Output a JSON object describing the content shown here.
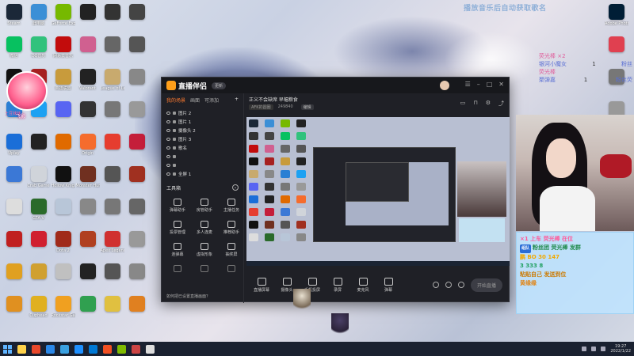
{
  "overlay": {
    "music_hint": "播放音乐后自动获取歌名"
  },
  "desktop_icons": [
    {
      "label": "Steam",
      "color": "#1b2838"
    },
    {
      "label": "此电脑",
      "color": "#3b8fd6"
    },
    {
      "label": "GeForce Experience",
      "color": "#76b900"
    },
    {
      "label": "",
      "color": "#222"
    },
    {
      "label": "",
      "color": "#333"
    },
    {
      "label": "",
      "color": "#444"
    },
    {
      "label": "微信",
      "color": "#07c160"
    },
    {
      "label": "QQ音乐",
      "color": "#31c27c"
    },
    {
      "label": "网易云音乐",
      "color": "#c20c0c"
    },
    {
      "label": "",
      "color": "#d06090"
    },
    {
      "label": "",
      "color": "#666"
    },
    {
      "label": "",
      "color": "#555"
    },
    {
      "label": "",
      "color": "#111"
    },
    {
      "label": "",
      "color": "#a62020"
    },
    {
      "label": "英雄联盟",
      "color": "#c89b3c"
    },
    {
      "label": "Valorant",
      "color": "#222"
    },
    {
      "label": "League of Legends",
      "color": "#c8aa6e"
    },
    {
      "label": "",
      "color": "#888"
    },
    {
      "label": "",
      "color": "#2a7fd4"
    },
    {
      "label": "",
      "color": "#1da1f2"
    },
    {
      "label": "",
      "color": "#5865f2"
    },
    {
      "label": "",
      "color": "#333"
    },
    {
      "label": "",
      "color": "#777"
    },
    {
      "label": "",
      "color": "#999"
    },
    {
      "label": "Uplay",
      "color": "#1a6ed8"
    },
    {
      "label": "",
      "color": "#222"
    },
    {
      "label": "",
      "color": "#e06a00"
    },
    {
      "label": "Origin",
      "color": "#f56c2d"
    },
    {
      "label": "",
      "color": "#e63d2f"
    },
    {
      "label": "",
      "color": "#c41e3a"
    },
    {
      "label": "",
      "color": "#3b78d6"
    },
    {
      "label": "Crab Game",
      "color": "#d0d4da"
    },
    {
      "label": "Hollow Knight",
      "color": "#111"
    },
    {
      "label": "Monster Hunter",
      "color": "#703020"
    },
    {
      "label": "",
      "color": "#555"
    },
    {
      "label": "",
      "color": "#a03020"
    },
    {
      "label": "",
      "color": "#ddd"
    },
    {
      "label": "GTA V",
      "color": "#2a6a2a"
    },
    {
      "label": "",
      "color": "#b8c6d8"
    },
    {
      "label": "",
      "color": "#888"
    },
    {
      "label": "",
      "color": "#777"
    },
    {
      "label": "",
      "color": "#666"
    },
    {
      "label": "",
      "color": "#c02020"
    },
    {
      "label": "",
      "color": "#d02030"
    },
    {
      "label": "Dota 2",
      "color": "#a02a1a"
    },
    {
      "label": "",
      "color": "#b04020"
    },
    {
      "label": "Apex Legends",
      "color": "#d03030"
    },
    {
      "label": "",
      "color": "#999"
    },
    {
      "label": "",
      "color": "#e0a020"
    },
    {
      "label": "",
      "color": "#d0a030"
    },
    {
      "label": "",
      "color": "#c0c0c0"
    },
    {
      "label": "",
      "color": "#222"
    },
    {
      "label": "",
      "color": "#555"
    },
    {
      "label": "",
      "color": "#888"
    },
    {
      "label": "",
      "color": "#e09020"
    },
    {
      "label": "Cuphead",
      "color": "#e0b020"
    },
    {
      "label": "Rockstar Games",
      "color": "#f0a020"
    },
    {
      "label": "",
      "color": "#30a050"
    },
    {
      "label": "",
      "color": "#e0c040"
    },
    {
      "label": "",
      "color": "#e08020"
    }
  ],
  "desktop_right_icons": [
    {
      "label": "Adobe Photosh...",
      "color": "#001e36"
    },
    {
      "label": "",
      "color": "#e04050"
    },
    {
      "label": "",
      "color": "#777"
    },
    {
      "label": "",
      "color": "#999"
    }
  ],
  "streamer_char": {
    "name": "飞影",
    "sub": "土豆妹妹"
  },
  "gift_board": [
    {
      "name": "荧光棒 ×2",
      "count": "",
      "cls": "g-a"
    },
    {
      "name": "银河小魔女",
      "count": "1",
      "extra": "粉丝",
      "cls": "g-b"
    },
    {
      "name": "荧光棒",
      "count": "",
      "cls": "g-a"
    },
    {
      "name": "聚弹嘉",
      "count": "1",
      "extra": "粉丝荧",
      "cls": "g-b"
    },
    {
      "name": "",
      "count": "",
      "cls": "g-c"
    }
  ],
  "app": {
    "name": "直播伴侣",
    "version": "更新",
    "tabs": [
      "我的场景",
      "画面",
      "可添加"
    ],
    "scenes": [
      "图片 2",
      "图片 1",
      "摄像头 2",
      "图片 3",
      "歌名",
      "",
      "",
      "全屏 1"
    ],
    "tools_title": "工具箱",
    "tools": [
      {
        "label": "弹幕助手"
      },
      {
        "label": "房管助手"
      },
      {
        "label": "主播任务"
      },
      {
        "label": "投票管理"
      },
      {
        "label": "多人连麦"
      },
      {
        "label": "推荐助手"
      },
      {
        "label": "连弹幕"
      },
      {
        "label": "虚拟形象"
      },
      {
        "label": "抽奖屏"
      },
      {
        "label": "",
        "dim": true
      },
      {
        "label": "",
        "dim": true
      },
      {
        "label": "",
        "dim": true
      }
    ],
    "footer_hint": "如何把已设置直播画面？",
    "title_line": "正义不会缺席 早幅粮食",
    "info": {
      "tag": "AFK的圆圈",
      "viewers": "249840",
      "edit": "编辑"
    },
    "controls": [
      "直播屏幕",
      "摄像头",
      "手机投屏",
      "录屏",
      "麦克风",
      "弹幕"
    ],
    "go_live": "开始直播"
  },
  "chat": [
    {
      "text": "×1  上车  荧光棒 在位",
      "cls": "c1",
      "badge": ""
    },
    {
      "text": "粉丝团 荧光棒 发群",
      "cls": "c2",
      "badge": "组队"
    },
    {
      "text": "鹏 BO 30 147",
      "cls": "c3",
      "badge": ""
    },
    {
      "text": "3 333 8",
      "cls": "c4",
      "badge": ""
    },
    {
      "text": "粘贴自己 发送到位",
      "cls": "c5",
      "badge": ""
    },
    {
      "text": "黄缘缘",
      "cls": "c6",
      "badge": ""
    }
  ],
  "taskbar": {
    "time": "19:27",
    "date": "2022/1/22",
    "colors": [
      "#ffd24a",
      "#e8482b",
      "#2b88e8",
      "#3aa0e0",
      "#1e90ff",
      "#0078d4",
      "#f25022",
      "#7fba00",
      "#c44",
      "#ddd"
    ]
  }
}
